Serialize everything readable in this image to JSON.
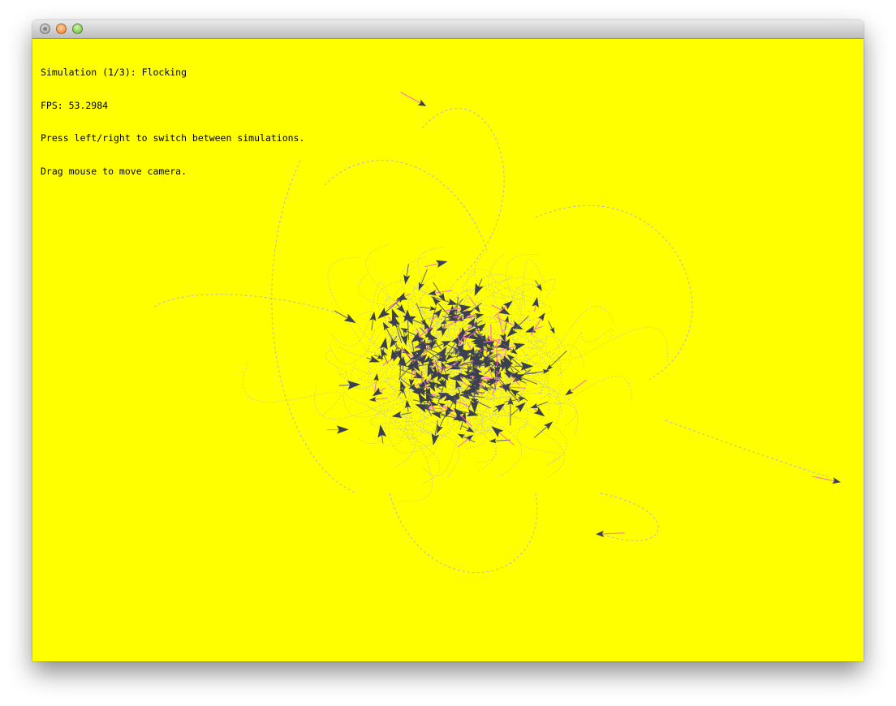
{
  "window": {
    "title": "",
    "buttons": [
      "close",
      "minimize",
      "zoom"
    ]
  },
  "hud": {
    "line1": "Simulation (1/3): Flocking",
    "line2": "FPS: 53.2984",
    "line3": "Press left/right to switch between simulations.",
    "line4": "Drag mouse to move camera."
  },
  "colors": {
    "background": "#ffff00",
    "boid": "#3a4050",
    "trail": "#b9b9b9",
    "velocity_line": "#ff66cc",
    "titlebar": "#d6d6d6"
  },
  "icons": {
    "close": "close-icon",
    "minimize": "minimize-icon",
    "zoom": "zoom-icon"
  }
}
